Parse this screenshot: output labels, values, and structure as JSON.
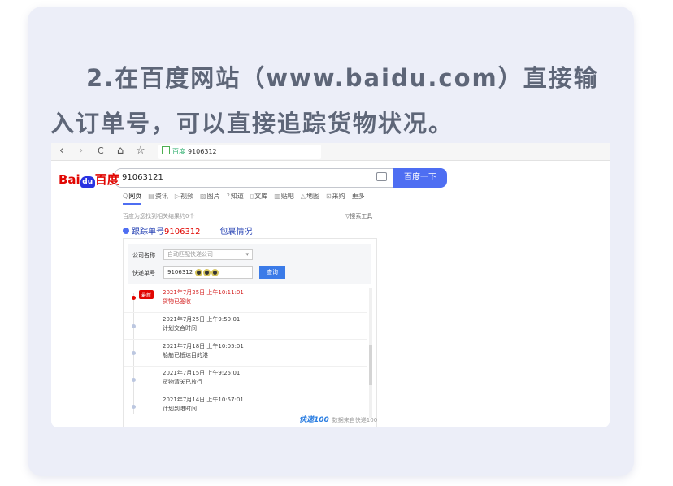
{
  "heading": {
    "line1": "2.在百度网站（www.baidu.com）直接输",
    "line2": "入订单号，可以直接追踪货物状况。"
  },
  "browser": {
    "back": "‹",
    "forward": "›",
    "reload": "C",
    "home": "⌂",
    "star": "☆",
    "tab_label": "百度",
    "address": "9106312"
  },
  "baidu": {
    "logo_left": "Bai",
    "logo_paw": "du",
    "logo_right": "百度",
    "search_value": "91063121",
    "search_button": "百度一下",
    "tabs": [
      {
        "icon": "Q",
        "label": "网页"
      },
      {
        "icon": "▤",
        "label": "资讯"
      },
      {
        "icon": "▷",
        "label": "视频"
      },
      {
        "icon": "▨",
        "label": "图片"
      },
      {
        "icon": "?",
        "label": "知道"
      },
      {
        "icon": "▯",
        "label": "文库"
      },
      {
        "icon": "▥",
        "label": "贴吧"
      },
      {
        "icon": "◬",
        "label": "地图"
      },
      {
        "icon": "⊡",
        "label": "采购"
      },
      {
        "icon": "",
        "label": "更多"
      }
    ],
    "result_info": "百度为您找到相关结果约0个",
    "search_tools": "▽搜索工具",
    "result_title_prefix": "跟踪单号",
    "result_title_number": "9106312",
    "result_title_suffix": "包裹情况"
  },
  "tracker": {
    "company_label": "公司名称",
    "company_value": "自动匹配快递公司",
    "tracking_label": "快递单号",
    "tracking_value": "9106312",
    "query_button": "查询",
    "latest_badge": "最新",
    "events": [
      {
        "time": "2021年7月25日 上午10:11:01",
        "status": "货物已签收"
      },
      {
        "time": "2021年7月25日 上午9:50:01",
        "status": "计划交合时间"
      },
      {
        "time": "2021年7月18日 上午10:05:01",
        "status": "船舶已抵达目的港"
      },
      {
        "time": "2021年7月15日 上午9:25:01",
        "status": "货物清关已放行"
      },
      {
        "time": "2021年7月14日 上午10:57:01",
        "status": "计划到港时间"
      }
    ],
    "footer_brand": "快递100",
    "footer_text": "数据来自快递100"
  }
}
